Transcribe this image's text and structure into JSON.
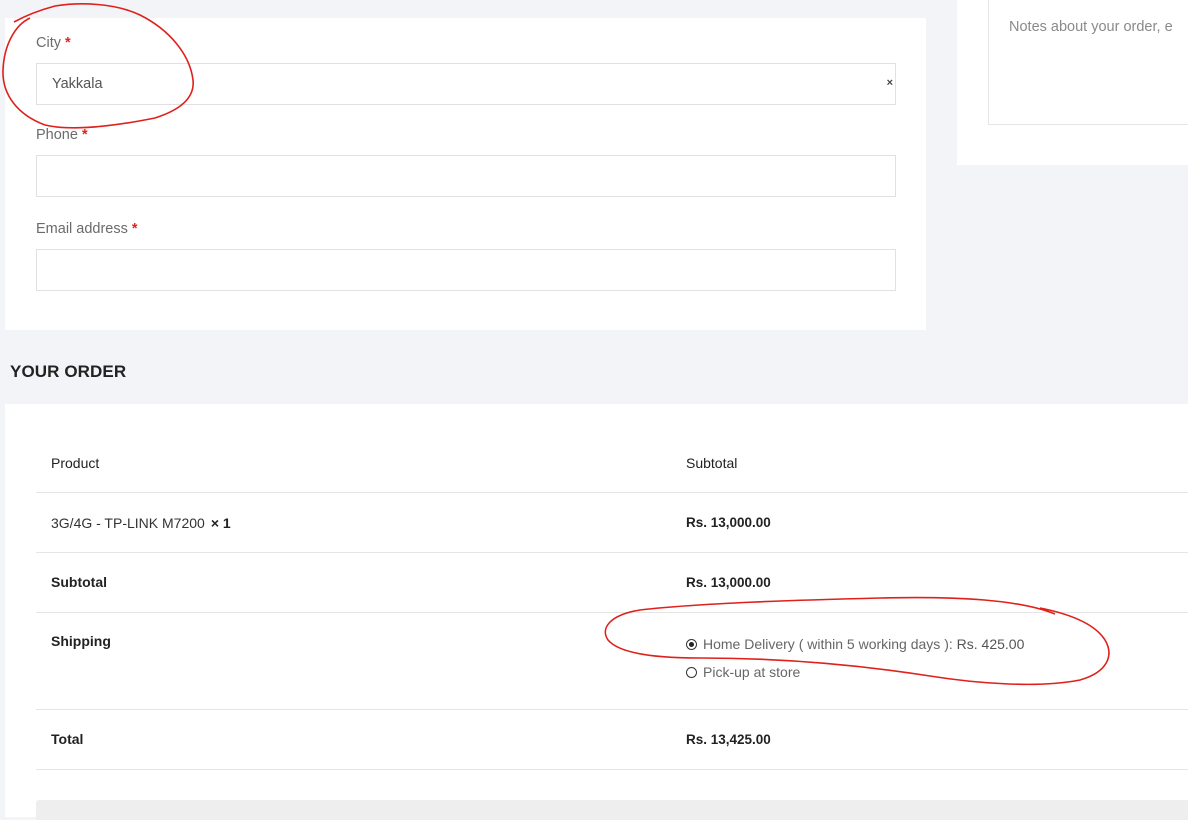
{
  "billing": {
    "city": {
      "label": "City",
      "required_mark": "*",
      "value": "Yakkala",
      "clear_icon": "×"
    },
    "phone": {
      "label": "Phone",
      "required_mark": "*",
      "value": ""
    },
    "email": {
      "label": "Email address",
      "required_mark": "*",
      "value": ""
    }
  },
  "notes": {
    "placeholder": "Notes about your order, e"
  },
  "order": {
    "heading": "YOUR ORDER",
    "columns": [
      "Product",
      "Subtotal"
    ],
    "item": {
      "name": "3G/4G - TP-LINK M7200",
      "qty": "× 1",
      "price": "Rs. 13,000.00"
    },
    "subtotal": {
      "label": "Subtotal",
      "value": "Rs. 13,000.00"
    },
    "shipping": {
      "label": "Shipping",
      "options": [
        {
          "label": "Home Delivery ( within 5 working days ):",
          "price": "Rs. 425.00",
          "selected": true
        },
        {
          "label": "Pick-up at store",
          "price": "",
          "selected": false
        }
      ]
    },
    "total": {
      "label": "Total",
      "value": "Rs. 13,425.00"
    }
  },
  "annotation_color": "#e0201a"
}
